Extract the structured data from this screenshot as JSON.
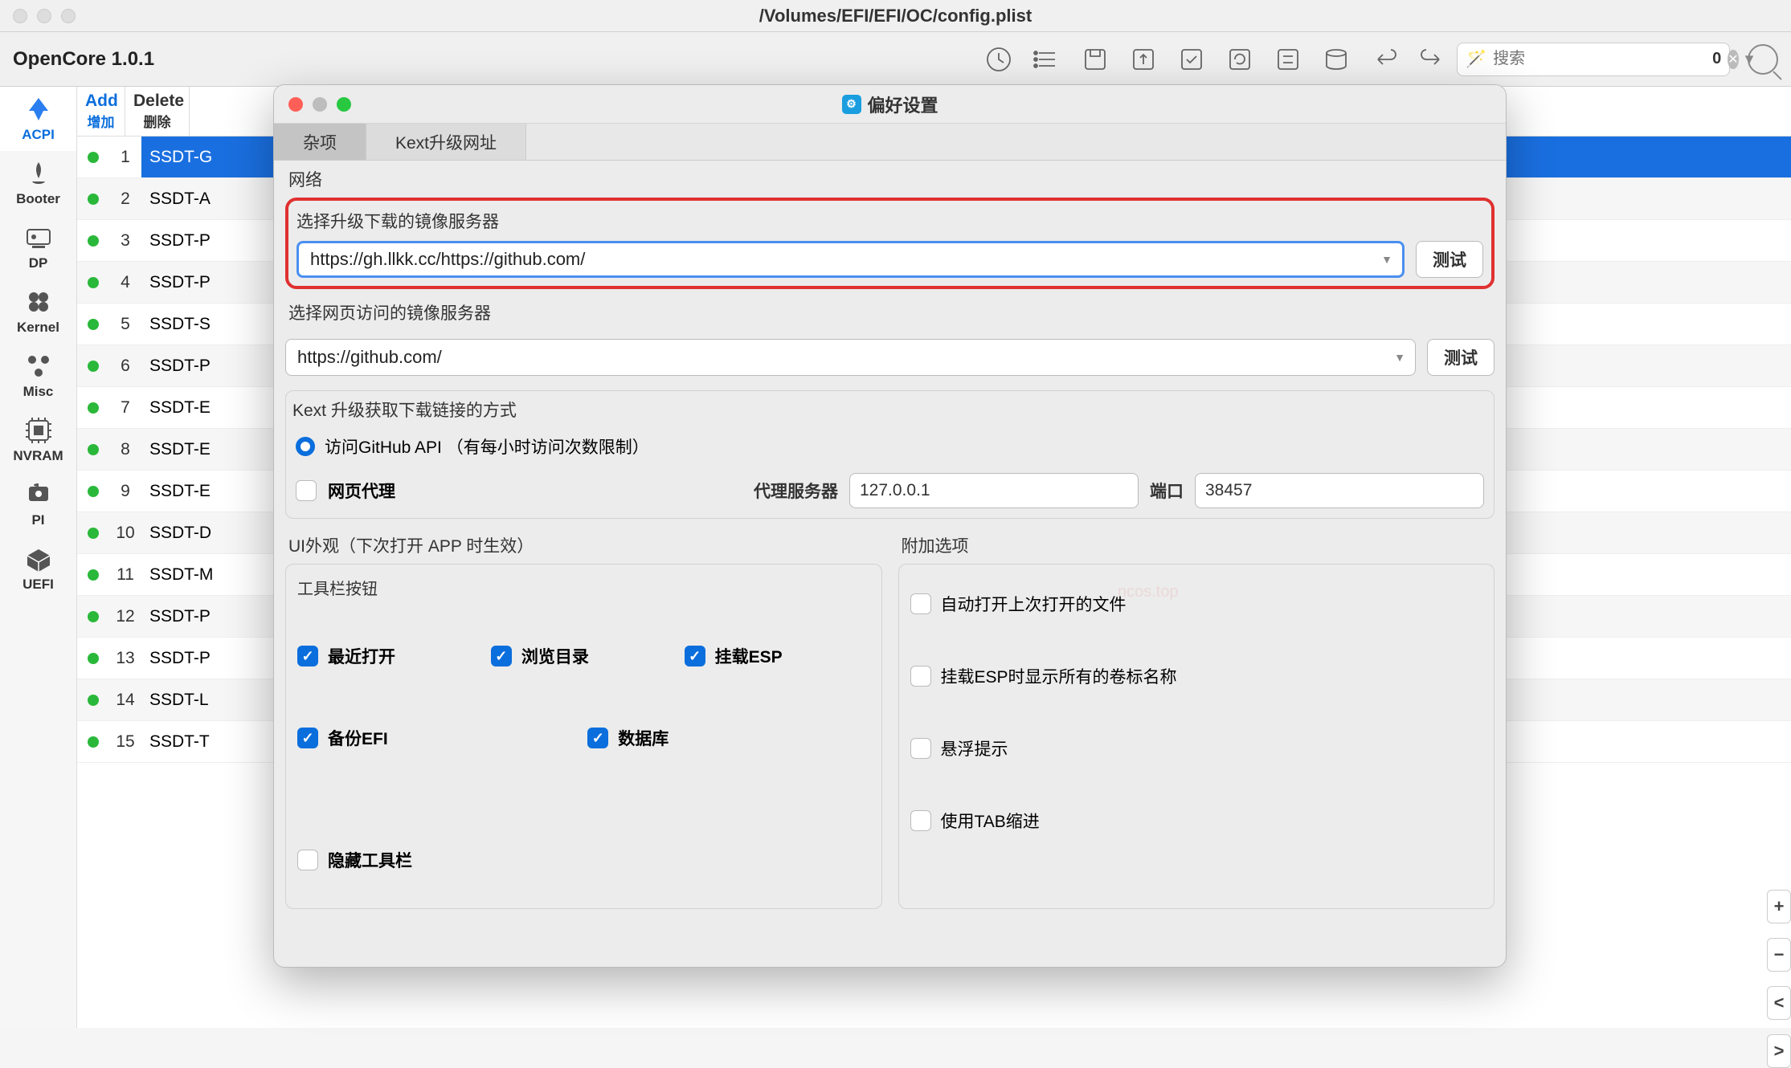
{
  "titlebar": {
    "path": "/Volumes/EFI/EFI/OC/config.plist"
  },
  "app": {
    "name": "OpenCore 1.0.1"
  },
  "search": {
    "placeholder": "搜索",
    "count": "0"
  },
  "sidebar": [
    {
      "label": "ACPI",
      "active": true
    },
    {
      "label": "Booter",
      "active": false
    },
    {
      "label": "DP",
      "active": false
    },
    {
      "label": "Kernel",
      "active": false
    },
    {
      "label": "Misc",
      "active": false
    },
    {
      "label": "NVRAM",
      "active": false
    },
    {
      "label": "PI",
      "active": false
    },
    {
      "label": "UEFI",
      "active": false
    }
  ],
  "table": {
    "add": {
      "en": "Add",
      "zh": "增加"
    },
    "delete": {
      "en": "Delete",
      "zh": "删除"
    },
    "rows": [
      {
        "idx": "1",
        "name": "SSDT-G",
        "selected": true
      },
      {
        "idx": "2",
        "name": "SSDT-A",
        "selected": false
      },
      {
        "idx": "3",
        "name": "SSDT-P",
        "selected": false
      },
      {
        "idx": "4",
        "name": "SSDT-P",
        "selected": false
      },
      {
        "idx": "5",
        "name": "SSDT-S",
        "selected": false
      },
      {
        "idx": "6",
        "name": "SSDT-P",
        "selected": false
      },
      {
        "idx": "7",
        "name": "SSDT-E",
        "selected": false
      },
      {
        "idx": "8",
        "name": "SSDT-E",
        "selected": false
      },
      {
        "idx": "9",
        "name": "SSDT-E",
        "selected": false
      },
      {
        "idx": "10",
        "name": "SSDT-D",
        "selected": false
      },
      {
        "idx": "11",
        "name": "SSDT-M",
        "selected": false
      },
      {
        "idx": "12",
        "name": "SSDT-P",
        "selected": false
      },
      {
        "idx": "13",
        "name": "SSDT-P",
        "selected": false
      },
      {
        "idx": "14",
        "name": "SSDT-L",
        "selected": false
      },
      {
        "idx": "15",
        "name": "SSDT-T",
        "selected": false
      }
    ]
  },
  "prefs": {
    "title": "偏好设置",
    "tabs": {
      "misc": "杂项",
      "kext": "Kext升级网址"
    },
    "network_label": "网络",
    "mirror_download_label": "选择升级下载的镜像服务器",
    "mirror_download_value": "https://gh.llkk.cc/https://github.com/",
    "mirror_web_label": "选择网页访问的镜像服务器",
    "mirror_web_value": "https://github.com/",
    "test_btn": "测试",
    "kext_method_label": "Kext 升级获取下载链接的方式",
    "github_api_label": "访问GitHub API （有每小时访问次数限制）",
    "web_proxy_label": "网页代理",
    "proxy_server_label": "代理服务器",
    "proxy_server_value": "127.0.0.1",
    "port_label": "端口",
    "port_value": "38457",
    "ui_appearance_label": "UI外观（下次打开 APP 时生效）",
    "toolbar_buttons_label": "工具栏按钮",
    "extra_options_label": "附加选项",
    "toolbar_opts": {
      "recent": "最近打开",
      "browse": "浏览目录",
      "mount": "挂载ESP",
      "backup": "备份EFI",
      "db": "数据库",
      "hide": "隐藏工具栏"
    },
    "extra_opts": {
      "auto_open": "自动打开上次打开的文件",
      "show_vols": "挂载ESP时显示所有的卷标名称",
      "hover_tip": "悬浮提示",
      "tab_indent": "使用TAB缩进"
    }
  },
  "watermark": "ncos.top"
}
